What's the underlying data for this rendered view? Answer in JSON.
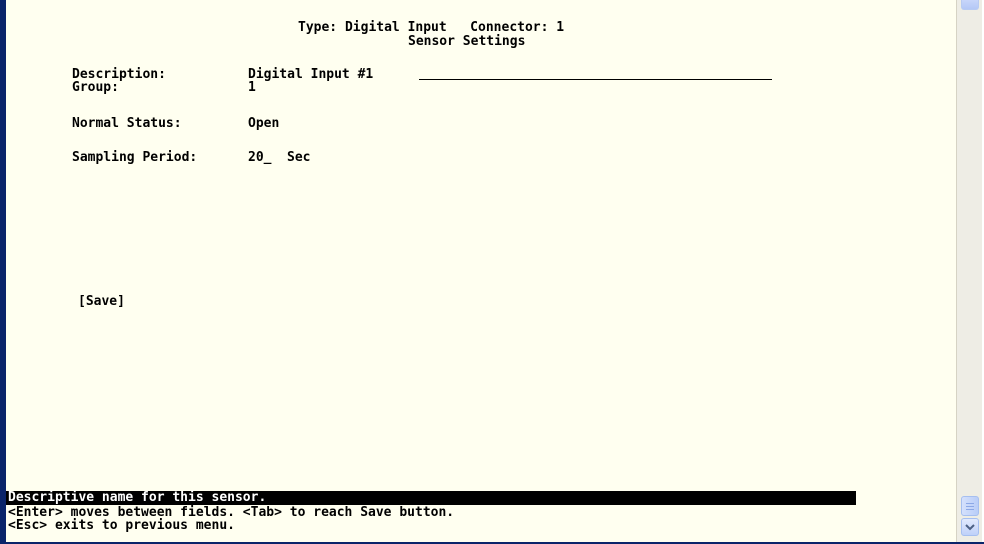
{
  "header": {
    "type_line": "Type: Digital Input   Connector: 1",
    "title": "Sensor Settings"
  },
  "fields": {
    "description": {
      "label": "Description:",
      "value": "Digital Input #1"
    },
    "group": {
      "label": "Group:",
      "value": "1"
    },
    "normal_status": {
      "label": "Normal Status:",
      "value": "Open"
    },
    "sampling_period": {
      "label": "Sampling Period:",
      "value": "20_",
      "unit": "Sec"
    }
  },
  "save_button": {
    "label": "[Save]"
  },
  "help": {
    "active_hint": "Descriptive name for this sensor.",
    "line1": "<Enter> moves between fields. <Tab> to reach Save button.",
    "line2": "<Esc> exits to previous menu."
  },
  "colors": {
    "terminal_background": "#fffff0",
    "text": "#000000",
    "highlight_background": "#000000",
    "highlight_text": "#ffffff",
    "window_edge": "#0a246a"
  },
  "icons": {
    "scroll_down": "chevron-down-icon"
  }
}
